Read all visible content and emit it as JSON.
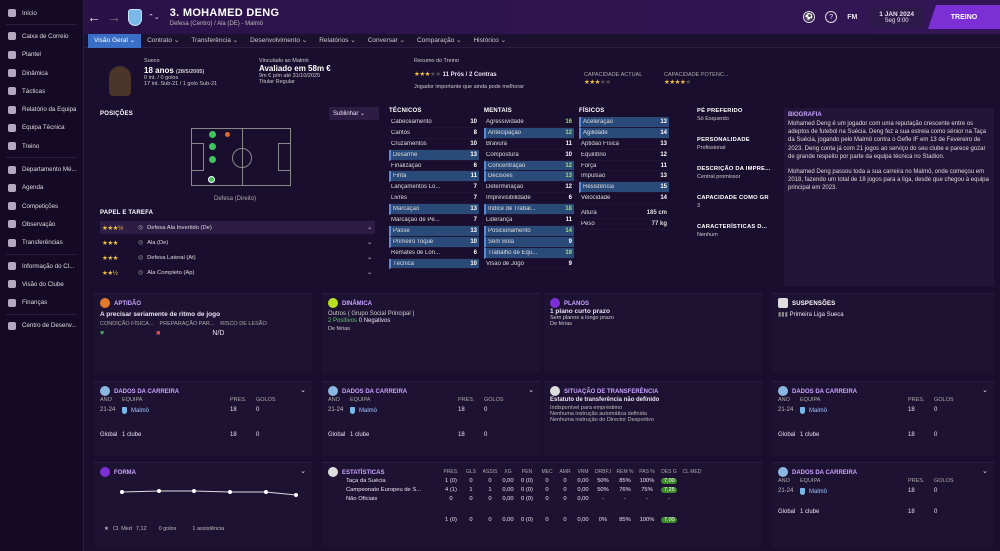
{
  "sidebar": {
    "items": [
      "Início",
      "Caixa de Correio",
      "Plantel",
      "Dinâmica",
      "Tácticas",
      "Relatório da Equipa",
      "Equipa Técnica",
      "Treino",
      "Departamento Mé...",
      "Agenda",
      "Competições",
      "Observação",
      "Transferências",
      "Informação do Cl...",
      "Visão do Clube",
      "Finanças",
      "Centro de Desenv..."
    ]
  },
  "header": {
    "title": "3. MOHAMED DENG",
    "subtitle": "Defesa (Centro) / Ala (DE) - Malmö",
    "fm": "FM",
    "date": "1 JAN 2024",
    "day": "Seg 9:00",
    "continue": "TREINO"
  },
  "tabs": [
    "Visão Geral",
    "Contrato",
    "Transferência",
    "Desenvolvimento",
    "Relatórios",
    "Conversar",
    "Comparação",
    "Histórico"
  ],
  "profile": {
    "nation": "Sueco",
    "age": "18 anos",
    "dob": "(28/5/2005)",
    "caps": "0 int. / 0 golos",
    "u21": "17 int. Sub-21 / 1 golo Sub-21",
    "contract_label": "Vinculado ao Malmö",
    "value": "Avaliado em 58m €",
    "wage": "9m € p/m até 31/10/2025",
    "status": "Titular Regular",
    "training_label": "Resumo do Treino",
    "pros": "11 Prós / 2 Contras",
    "training_note": "Jogador importante que ainda pode melhorar",
    "ca_label": "CAPACIDADE ACTUAL",
    "pa_label": "CAPACIDADE POTENC..."
  },
  "positions": {
    "title": "POSIÇÕES",
    "filter": "Sublinhar",
    "caption": "Defesa (Direito)"
  },
  "roles": {
    "title": "PAPEL E TAREFA",
    "items": [
      "Defesa Ala Invertido (De)",
      "Ala (De)",
      "Defesa Lateral (At)",
      "Ala Completo (Ap)"
    ]
  },
  "tecnicos": {
    "title": "TÉCNICOS",
    "items": [
      [
        "Cabeceamento",
        "10"
      ],
      [
        "Cantos",
        "8"
      ],
      [
        "Cruzamentos",
        "10"
      ],
      [
        "Desarme",
        "13"
      ],
      [
        "Finalização",
        "6"
      ],
      [
        "Finta",
        "11"
      ],
      [
        "Lançamentos Lo...",
        "7"
      ],
      [
        "Livres",
        "7"
      ],
      [
        "Marcação",
        "13"
      ],
      [
        "Marcação de Pe...",
        "7"
      ],
      [
        "Passe",
        "13"
      ],
      [
        "Primeiro Toque",
        "10"
      ],
      [
        "Remates de Lon...",
        "6"
      ],
      [
        "Técnica",
        "10"
      ]
    ]
  },
  "mentais": {
    "title": "MENTAIS",
    "items": [
      [
        "Agressividade",
        "16"
      ],
      [
        "Antecipação",
        "12"
      ],
      [
        "Bravura",
        "11"
      ],
      [
        "Compostura",
        "10"
      ],
      [
        "Concentração",
        "12"
      ],
      [
        "Decisões",
        "13"
      ],
      [
        "Determinação",
        "12"
      ],
      [
        "Imprevisibilidade",
        "6"
      ],
      [
        "Índice de Trabal...",
        "18"
      ],
      [
        "Liderança",
        "11"
      ],
      [
        "Posicionamento",
        "14"
      ],
      [
        "Sem Bola",
        "9"
      ],
      [
        "Trabalho de Equ...",
        "19"
      ],
      [
        "Visão de Jogo",
        "9"
      ]
    ]
  },
  "fisicos": {
    "title": "FÍSICOS",
    "items": [
      [
        "Aceleração",
        "13"
      ],
      [
        "Agilidade",
        "14"
      ],
      [
        "Aptidão Física",
        "13"
      ],
      [
        "Equilíbrio",
        "12"
      ],
      [
        "Força",
        "11"
      ],
      [
        "Impulsão",
        "13"
      ],
      [
        "Resistência",
        "15"
      ],
      [
        "Velocidade",
        "14"
      ]
    ],
    "height_label": "Altura",
    "height": "185 cm",
    "weight_label": "Peso",
    "weight": "77 kg"
  },
  "info": {
    "foot_label": "PÉ PREFERIDO",
    "foot": "Só Esquerdo",
    "pers_label": "PERSONALIDADE",
    "pers": "Profissional",
    "desc_label": "DESCRIÇÃO DA IMPRE...",
    "desc": "Central promissor",
    "gk_label": "CAPACIDADE COMO GR",
    "gk": "3",
    "traits_label": "CARACTERÍSTICAS D...",
    "traits": "Nenhum"
  },
  "bio": {
    "title": "BIOGRAFIA",
    "p1": "Mohamed Deng é um jogador com uma reputação crescente entre os adeptos de futebol na Suécia. Deng fez a sua estreia como sénior na Taça da Suécia, jogando pelo Malmö contra o Gefle IF em 13 de Fevereiro de 2023. Deng conta já com 21 jogos ao serviço do seu clube e parece gozar de grande respeito por parte da equipa técnica no Stadion.",
    "p2": "Mohamed Deng passou toda a sua carreira no Malmö, onde começou em 2018, fazendo um total de 18 jogos para a liga, desde que chegou à equipa principal em 2023."
  },
  "aptidao": {
    "title": "APTIDÃO",
    "text": "A precisar seriamente de ritmo de jogo",
    "l1": "CONDIÇÃO FÍSICA...",
    "l2": "PREPARAÇÃO PAR...",
    "l3": "RISCO DE LESÃO",
    "v3": "N/D"
  },
  "dinamica": {
    "title": "DINÂMICA",
    "l1": "Outros",
    "l2": "( Grupo Social Principal )",
    "pos": "2 Positivos",
    "neg": "0 Negativos",
    "ferias": "De férias"
  },
  "planos": {
    "title": "PLANOS",
    "l1": "1 plano curto prazo",
    "l2": "Sem planos a longo prazo",
    "l3": "De férias"
  },
  "susp": {
    "title": "SUSPENSÕES",
    "l1": "Primeira Liga Sueca"
  },
  "carreira": {
    "title": "DADOS DA CARREIRA",
    "ano": "ANO",
    "equipa": "EQUIPA",
    "pres": "PRES.",
    "golos": "GOLOS",
    "year": "21-24",
    "team": "Malmö",
    "p": "18",
    "g": "0",
    "global": "Global",
    "clube": "1 clube"
  },
  "transfer": {
    "title": "SITUAÇÃO DE TRANSFERÊNCIA",
    "l1": "Estatuto de transferência não definido",
    "l2": "Indisponível para empréstimo",
    "l3": "Nenhuma instrução automática definida",
    "l4": "Nenhuma instrução do Director Desportivo"
  },
  "forma": {
    "title": "FORMA",
    "cl": "Cl. Med",
    "clv": "7,12",
    "golos": "0 golos",
    "assist": "1 assistência"
  },
  "estat": {
    "title": "ESTATÍSTICAS",
    "head": [
      "PRES.",
      "GLS",
      "ASSIS",
      "XG",
      "PEN",
      "MEC",
      "AMR",
      "VRM",
      "DRBFJ",
      "REM %",
      "PAS %",
      "DES G",
      "CL MED"
    ],
    "rows": [
      [
        "Taça da Suécia",
        "1 (0)",
        "0",
        "0",
        "0,00",
        "0 (0)",
        "0",
        "0",
        "0,00",
        "50%",
        "85%",
        "100%",
        "7,00"
      ],
      [
        "Campeonato Europeu de S...",
        "4 (1)",
        "1",
        "1",
        "0,00",
        "0 (0)",
        "0",
        "0",
        "0,00",
        "50%",
        "76%",
        "75%",
        "7,25"
      ],
      [
        "Não Oficiais",
        "0",
        "0",
        "0",
        "0,00",
        "0 (0)",
        "0",
        "0",
        "0,00",
        "-",
        "-",
        "-",
        "-"
      ]
    ],
    "total": [
      "1 (0)",
      "0",
      "0",
      "0,00",
      "0 (0)",
      "0",
      "0",
      "0,00",
      "0%",
      "85%",
      "100%",
      "7,00"
    ]
  }
}
